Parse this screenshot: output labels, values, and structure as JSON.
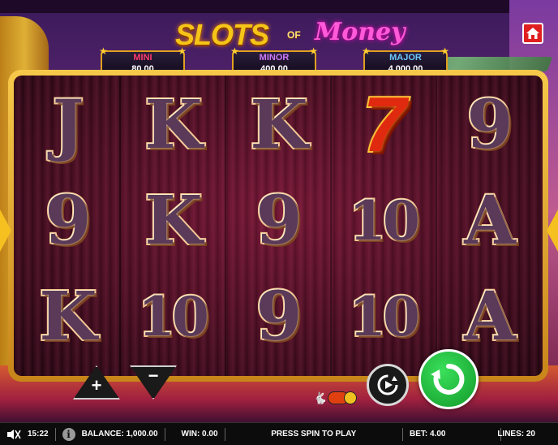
{
  "logo": {
    "slots": "SLOTS",
    "of": "OF",
    "money": "Money"
  },
  "jackpots": {
    "mini": {
      "label": "MINI",
      "value": "80.00"
    },
    "minor": {
      "label": "MINOR",
      "value": "400.00"
    },
    "major": {
      "label": "MAJOR",
      "value": "4,000.00"
    }
  },
  "reels": [
    [
      "J",
      "9",
      "K"
    ],
    [
      "K",
      "K",
      "10"
    ],
    [
      "K",
      "9",
      "9"
    ],
    [
      "7",
      "10",
      "10"
    ],
    [
      "9",
      "A",
      "A"
    ]
  ],
  "controls": {
    "plus": "+",
    "minus": "−"
  },
  "status_bar": {
    "time": "15:22",
    "balance": "BALANCE: 1,000.00",
    "win": "WIN: 0.00",
    "message": "PRESS SPIN TO PLAY",
    "bet": "BET: 4.00",
    "lines": "LINES: 20"
  },
  "colors": {
    "spin": "#1fb83a",
    "frame_gold": "#f7c94a",
    "home": "#e02020",
    "mini": "#ff3a6a",
    "minor": "#d07aff",
    "major": "#6ac8ff"
  },
  "icons": [
    "home-icon",
    "sound-muted-icon",
    "info-icon",
    "autoplay-icon",
    "spin-icon",
    "turbo-rabbit-icon"
  ]
}
